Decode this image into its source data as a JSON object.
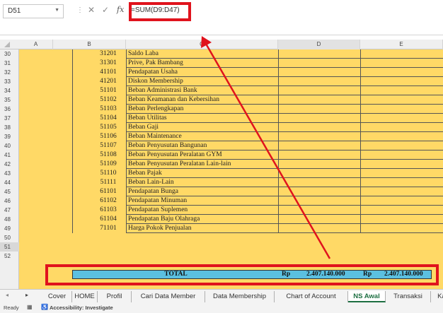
{
  "formula_bar": {
    "name_box": "D51",
    "fx": "fx",
    "formula": "=SUM(D9:D47)"
  },
  "columns": [
    "A",
    "B",
    "C",
    "D",
    "E"
  ],
  "rows": [
    {
      "num": "30",
      "code": "31201",
      "name": "Saldo Laba"
    },
    {
      "num": "31",
      "code": "31301",
      "name": "Prive, Pak Bambang"
    },
    {
      "num": "32",
      "code": "41101",
      "name": "Pendapatan Usaha"
    },
    {
      "num": "33",
      "code": "41201",
      "name": "Diskon Membership"
    },
    {
      "num": "34",
      "code": "51101",
      "name": "Beban Administrasi Bank"
    },
    {
      "num": "35",
      "code": "51102",
      "name": "Beban Keamanan dan Kebersihan"
    },
    {
      "num": "36",
      "code": "51103",
      "name": "Beban Perlengkapan"
    },
    {
      "num": "37",
      "code": "51104",
      "name": "Beban Utilitas"
    },
    {
      "num": "38",
      "code": "51105",
      "name": "Beban Gaji"
    },
    {
      "num": "39",
      "code": "51106",
      "name": "Beban Maintenance"
    },
    {
      "num": "40",
      "code": "51107",
      "name": "Beban Penyusutan Bangunan"
    },
    {
      "num": "41",
      "code": "51108",
      "name": "Beban Penyusutan Peralatan GYM"
    },
    {
      "num": "42",
      "code": "51109",
      "name": "Beban Penyusutan Peralatan Lain-lain"
    },
    {
      "num": "43",
      "code": "51110",
      "name": "Beban Pajak"
    },
    {
      "num": "44",
      "code": "51111",
      "name": "Beban Lain-Lain"
    },
    {
      "num": "45",
      "code": "61101",
      "name": "Pendapatan Bunga"
    },
    {
      "num": "46",
      "code": "61102",
      "name": "Pendapatan Minuman"
    },
    {
      "num": "47",
      "code": "61103",
      "name": "Pendapatan Suplemen"
    },
    {
      "num": "48",
      "code": "61104",
      "name": "Pendapatan Baju Olahraga"
    },
    {
      "num": "49",
      "code": "71101",
      "name": "Harga Pokok Penjualan"
    }
  ],
  "extra_rows": [
    "50",
    "51",
    "52"
  ],
  "total": {
    "label": "TOTAL",
    "currency": "Rp",
    "debit": "2.407.140.000",
    "credit": "2.407.140.000"
  },
  "tabs": [
    {
      "label": "Cover",
      "active": false
    },
    {
      "label": "HOME",
      "active": false
    },
    {
      "label": "Profil",
      "active": false
    },
    {
      "label": "Cari Data Member",
      "active": false
    },
    {
      "label": "Data Membership",
      "active": false
    },
    {
      "label": "Chart of Account",
      "active": false
    },
    {
      "label": "NS Awal",
      "active": true
    },
    {
      "label": "Transaksi",
      "active": false
    },
    {
      "label": "Kartu",
      "active": false
    }
  ],
  "status": {
    "ready": "Ready",
    "accessibility": "Accessibility: Investigate"
  },
  "annotation_color": "#e0131d",
  "sheet_fill_color": "#ffd966",
  "total_fill_color": "#5bc0e0"
}
